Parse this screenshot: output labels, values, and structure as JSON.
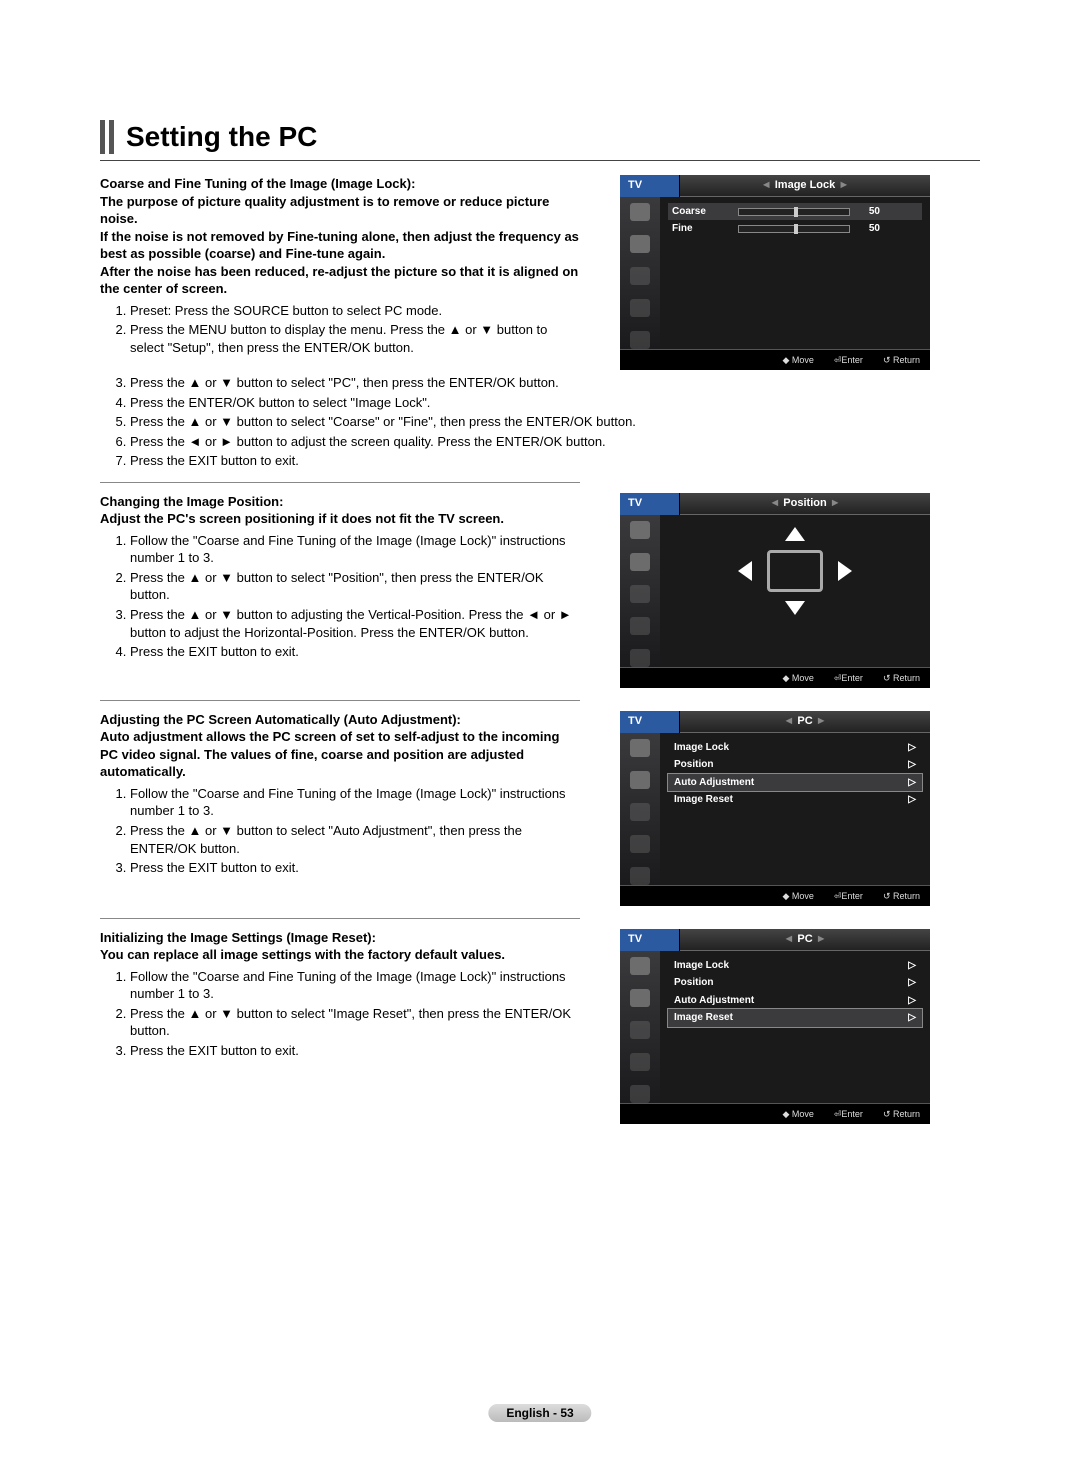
{
  "title": "Setting the PC",
  "sections": {
    "imageLock": {
      "heading": "Coarse and Fine Tuning of the Image (Image Lock):",
      "intro": "The purpose of picture quality adjustment is to remove or reduce picture noise.\nIf the noise is not removed by Fine-tuning alone, then adjust the frequency as best as possible (coarse) and Fine-tune again.\nAfter the noise has been reduced, re-adjust the picture so that it is aligned on the center of screen.",
      "steps": [
        "Preset: Press the SOURCE button to select PC mode.",
        "Press the MENU button to display the menu. Press the ▲ or ▼ button to select \"Setup\", then press the ENTER/OK button.",
        "Press the ▲ or ▼ button to select \"PC\", then press the ENTER/OK button.",
        "Press the ENTER/OK button to select \"Image Lock\".",
        "Press the ▲ or ▼ button to select \"Coarse\" or \"Fine\", then press the ENTER/OK button.",
        "Press the ◄ or ► button to adjust the screen quality. Press the ENTER/OK button.",
        "Press the EXIT button to exit."
      ]
    },
    "position": {
      "heading": "Changing the Image Position:",
      "intro": "Adjust the PC's screen positioning if it does not fit the TV screen.",
      "steps": [
        "Follow the \"Coarse and Fine Tuning of the Image (Image Lock)\" instructions number 1 to 3.",
        "Press the ▲ or ▼ button to select \"Position\", then press the ENTER/OK button.",
        "Press the ▲ or ▼ button to adjusting the Vertical-Position. Press the ◄ or ► button to adjust the Horizontal-Position. Press the ENTER/OK button.",
        "Press the EXIT button to exit."
      ]
    },
    "autoAdjust": {
      "heading": "Adjusting the PC Screen Automatically (Auto Adjustment):",
      "intro": "Auto adjustment allows the PC screen of set to self-adjust to the incoming PC video signal. The values of fine, coarse and position are adjusted automatically.",
      "steps": [
        "Follow the \"Coarse and Fine Tuning of the Image (Image Lock)\" instructions number 1 to 3.",
        "Press the ▲ or ▼ button to select \"Auto Adjustment\", then press the ENTER/OK button.",
        "Press the EXIT button to exit."
      ]
    },
    "imageReset": {
      "heading": "Initializing the Image Settings (Image Reset):",
      "intro": "You can replace all image settings with the factory default values.",
      "steps": [
        "Follow the \"Coarse and Fine Tuning of the Image (Image Lock)\" instructions number 1 to 3.",
        "Press the ▲ or ▼ button to select \"Image Reset\", then press the ENTER/OK button.",
        "Press the EXIT button to exit."
      ]
    }
  },
  "osd": {
    "tvLabel": "TV",
    "footer": {
      "move": "Move",
      "enter": "Enter",
      "return": "Return"
    },
    "screen1": {
      "title": "Image Lock",
      "rows": [
        {
          "label": "Coarse",
          "value": "50",
          "selected": true
        },
        {
          "label": "Fine",
          "value": "50",
          "selected": false
        }
      ]
    },
    "screen2": {
      "title": "Position"
    },
    "screen3": {
      "title": "PC",
      "items": [
        {
          "label": "Image Lock"
        },
        {
          "label": "Position"
        },
        {
          "label": "Auto Adjustment",
          "selected": true
        },
        {
          "label": "Image Reset"
        }
      ]
    },
    "screen4": {
      "title": "PC",
      "items": [
        {
          "label": "Image Lock"
        },
        {
          "label": "Position"
        },
        {
          "label": "Auto Adjustment"
        },
        {
          "label": "Image Reset",
          "selected": true
        }
      ]
    }
  },
  "pageNumber": "English - 53"
}
